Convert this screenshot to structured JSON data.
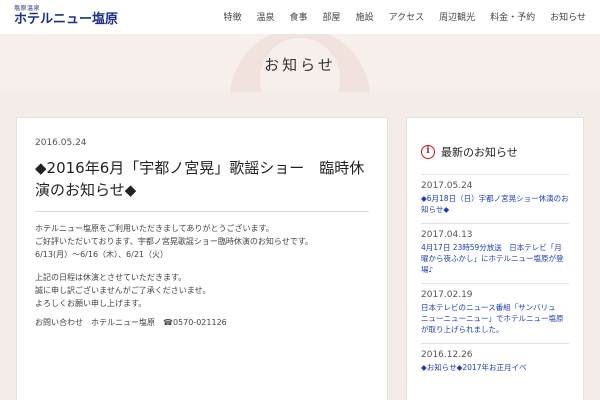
{
  "logo": {
    "small": "塩原温泉",
    "main": "ホテルニュー塩原"
  },
  "nav": [
    "特徴",
    "温泉",
    "食事",
    "部屋",
    "施設",
    "アクセス",
    "周辺観光",
    "料金・予約",
    "お知らせ"
  ],
  "page_title": "お知らせ",
  "article": {
    "date": "2016.05.24",
    "title": "◆2016年6月「宇都ノ宮晃」歌謡ショー　臨時休演のお知らせ◆",
    "p1": "ホテルニュー塩原をご利用いただきましてありがとうございます。",
    "p2": "ご好評いただいております、宇都ノ宮晃歌謡ショー臨時休演のお知らせです。",
    "p3": "6/13(月）～6/16（木）、6/21（火）",
    "p4": "上記の日程は休演とさせていただきます。",
    "p5": "誠に申し訳ございませんがご了承くださいませ。",
    "p6": "よろしくお願い申し上げます。",
    "contact": "お問い合わせ　ホテルニュー塩原　☎0570-021126"
  },
  "sidebar": {
    "icon": "info-icon",
    "title": "最新のお知らせ",
    "items": [
      {
        "date": "2017.05.24",
        "text": "◆6月18日（日）宇都ノ宮晃ショー休演のお知らせ◆"
      },
      {
        "date": "2017.04.13",
        "text": "4月17日 23時59分放送　日本テレビ「月曜から夜ふかし」にホテルニュー塩原が登場♪"
      },
      {
        "date": "2017.02.19",
        "text": "日本テレビのニュース番組「サンバリュ　ニューニューニュー」でホテルニュー塩原が取り上げられました。"
      },
      {
        "date": "2016.12.26",
        "text": "◆お知らせ◆2017年お正月イベ"
      }
    ]
  }
}
